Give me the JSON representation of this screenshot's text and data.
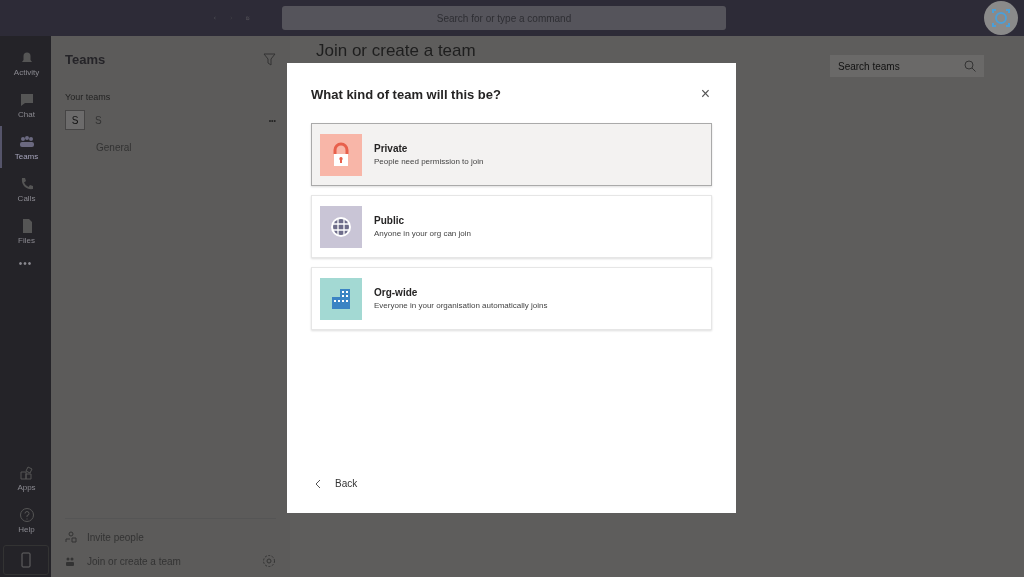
{
  "top_bar": {
    "search_placeholder": "Search for or type a command"
  },
  "rail": [
    {
      "label": "Activity",
      "kind": "bell",
      "selected": false
    },
    {
      "label": "Chat",
      "kind": "chat",
      "selected": false
    },
    {
      "label": "Teams",
      "kind": "teams",
      "selected": true
    },
    {
      "label": "Calls",
      "kind": "phone",
      "selected": false
    },
    {
      "label": "Files",
      "kind": "file",
      "selected": false
    }
  ],
  "rail_more": "•••",
  "rail_bottom": [
    {
      "label": "Apps",
      "kind": "apps"
    },
    {
      "label": "Help",
      "kind": "help"
    }
  ],
  "left_panel": {
    "title": "Teams",
    "section": "Your teams",
    "team": {
      "initial": "S",
      "name": "S",
      "more": "•••",
      "channels": [
        "General"
      ]
    },
    "footer": [
      {
        "label": "Invite people",
        "kind": "invite"
      },
      {
        "label": "Join or create a team",
        "kind": "join"
      }
    ]
  },
  "main": {
    "title": "Join or create a team",
    "search_placeholder": "Search teams"
  },
  "dialog": {
    "title": "What kind of team will this be?",
    "close": "×",
    "options": [
      {
        "kind": "lock",
        "title": "Private",
        "description": "People need permission to join",
        "color": "#f8b6a8",
        "selected": true
      },
      {
        "kind": "globe",
        "title": "Public",
        "description": "Anyone in your org can join",
        "color": "#c9c5d6",
        "selected": false
      },
      {
        "kind": "building",
        "title": "Org-wide",
        "description": "Everyone in your organisation automatically joins",
        "color": "#a3d9d3",
        "selected": false
      }
    ],
    "back": "Back"
  }
}
